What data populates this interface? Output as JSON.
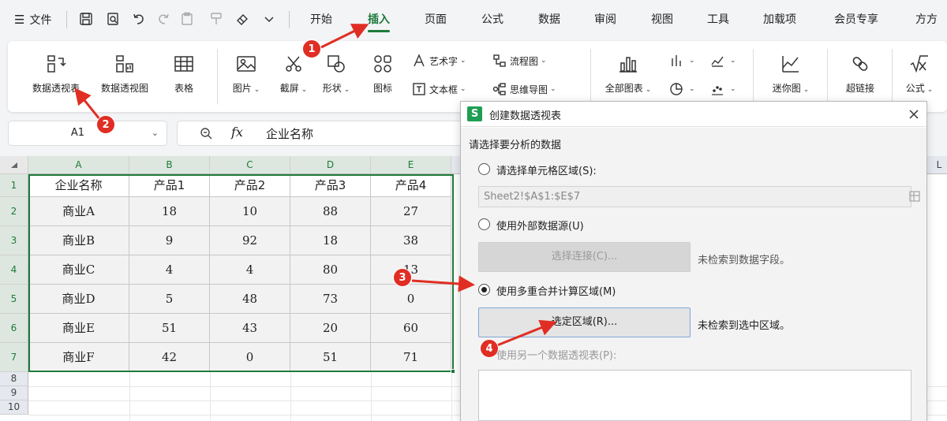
{
  "menubar": {
    "file_label": "文件",
    "tabs": [
      "开始",
      "插入",
      "页面",
      "公式",
      "数据",
      "审阅",
      "视图",
      "工具",
      "加载项",
      "会员专享",
      "方方"
    ],
    "active_tab": "插入"
  },
  "ribbon": {
    "big": [
      "数据透视表",
      "数据透视图",
      "表格",
      "图片",
      "截屏",
      "形状",
      "图标",
      "全部图表",
      "迷你图",
      "超链接",
      "公式"
    ],
    "small": {
      "art_text": "艺术字",
      "flowchart": "流程图",
      "textbox": "文本框",
      "mindmap": "思维导图"
    }
  },
  "namebox": {
    "value": "A1"
  },
  "formula": {
    "value": "企业名称"
  },
  "sheet": {
    "columns": [
      "A",
      "B",
      "C",
      "D",
      "E"
    ],
    "next_column": "L",
    "rows": [
      "1",
      "2",
      "3",
      "4",
      "5",
      "6",
      "7",
      "8",
      "9",
      "10"
    ],
    "header": [
      "企业名称",
      "产品1",
      "产品2",
      "产品3",
      "产品4"
    ],
    "data": [
      [
        "商业A",
        "18",
        "10",
        "88",
        "27"
      ],
      [
        "商业B",
        "9",
        "92",
        "18",
        "38"
      ],
      [
        "商业C",
        "4",
        "4",
        "80",
        "13"
      ],
      [
        "商业D",
        "5",
        "48",
        "73",
        "0"
      ],
      [
        "商业E",
        "51",
        "43",
        "20",
        "60"
      ],
      [
        "商业F",
        "42",
        "0",
        "51",
        "71"
      ]
    ]
  },
  "dialog": {
    "logo": "S",
    "title": "创建数据透视表",
    "section_label": "请选择要分析的数据",
    "opt_cell_range": "请选择单元格区域(S):",
    "range_value": "Sheet2!$A$1:$E$7",
    "opt_external": "使用外部数据源(U)",
    "select_connection": "选择连接(C)...",
    "no_fields": "未检索到数据字段。",
    "opt_multi": "使用多重合并计算区域(M)",
    "select_region": "选定区域(R)...",
    "no_region": "未检索到选中区域。",
    "opt_other_pivot": "使用另一个数据透视表(P):"
  },
  "annotations": [
    "1",
    "2",
    "3",
    "4"
  ],
  "colors": {
    "accent": "#1e7a3b",
    "badge": "#e02e24",
    "logo": "#1e9e52"
  }
}
